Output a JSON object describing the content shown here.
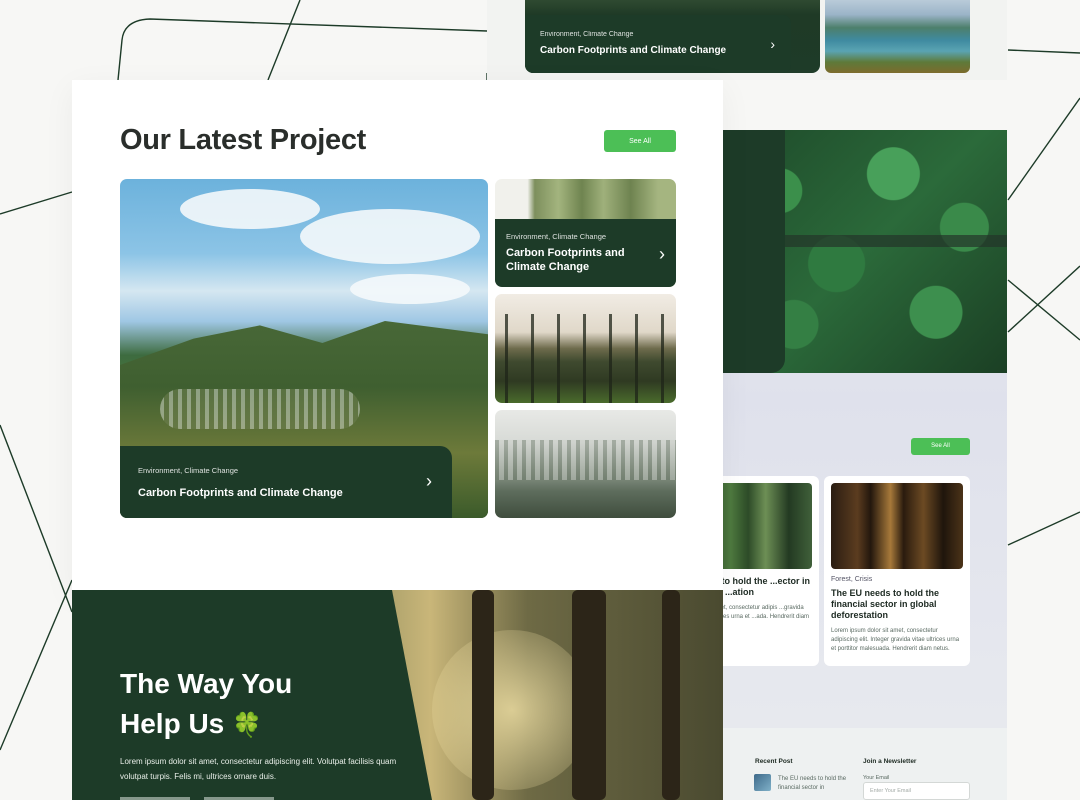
{
  "colors": {
    "dark_green": "#1d3b28",
    "accent_green": "#4cbf56",
    "panel": "#ffffff",
    "background": "#f7f7f5"
  },
  "top_card": {
    "category": "Environment, Climate Change",
    "title": "Carbon Footprints and Climate Change",
    "chevron": "›"
  },
  "main": {
    "title": "Our Latest Project",
    "see_all_label": "See All",
    "featured": {
      "category": "Environment, Climate Change",
      "title": "Carbon Footprints and Climate Change",
      "chevron": "›"
    },
    "side_cards": [
      {
        "category": "Environment, Climate Change",
        "title": "Carbon Footprints and Climate Change",
        "chevron": "›"
      }
    ]
  },
  "help": {
    "title_line1": "The Way You",
    "title_line2": "Help Us",
    "clover": "🍀",
    "text": "Lorem ipsum dolor sit amet, consectetur adipiscing elit. Volutpat facilisis quam volutpat turpis. Felis mi, ultrices ornare duis."
  },
  "right_blog": {
    "see_all_label": "See All",
    "cards": [
      {
        "category": "",
        "title": "...eds to hold the ...ector in global ...ation",
        "text": "...r sit amet, consectetur adipis ...gravida vitae ultrices urna et ...ada. Hendrerit diam netus."
      },
      {
        "category": "Forest, Crisis",
        "title": "The EU needs to hold the financial sector in global deforestation",
        "text": "Lorem ipsum dolor sit amet, consectetur adipiscing elit. Integer gravida vitae ultrices urna et porttitor malesuada. Hendrerit diam netus."
      }
    ]
  },
  "footer": {
    "recent_post_title": "Recent Post",
    "recent_post_text": "The EU needs to hold the financial sector in",
    "newsletter_title": "Join a Newsletter",
    "email_label": "Your Email",
    "email_placeholder": "Enter Your Email"
  }
}
